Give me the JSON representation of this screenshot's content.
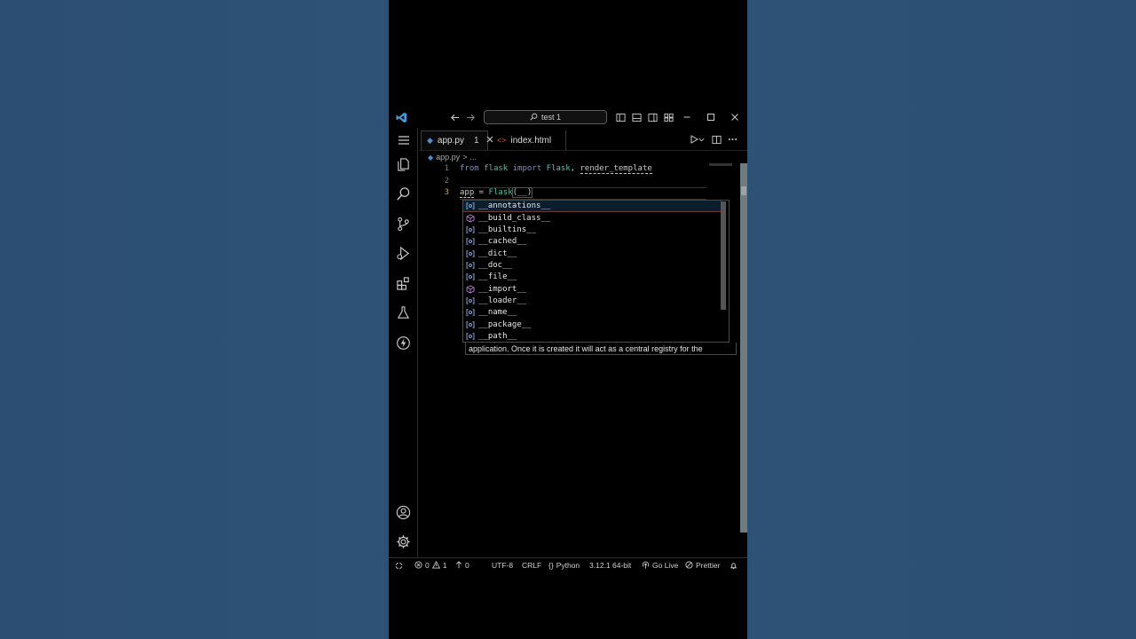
{
  "window": {
    "search_text": "test 1"
  },
  "tabs": [
    {
      "label": "app.py",
      "badge": "1"
    },
    {
      "label": "index.html"
    }
  ],
  "breadcrumb": {
    "file": "app.py",
    "sep": ">",
    "rest": "..."
  },
  "editor": {
    "lines": [
      {
        "number": "1"
      },
      {
        "number": "2"
      },
      {
        "number": "3"
      }
    ],
    "line1": {
      "from": "from",
      "module": "flask",
      "import": "import",
      "name1": "Flask",
      "comma": ", ",
      "name2": "render_template"
    },
    "line3": {
      "var": "app",
      "eq": " = ",
      "call": "Flask",
      "args": "(__)"
    }
  },
  "suggestions": [
    {
      "label": "__annotations__",
      "kind": "variable-icon"
    },
    {
      "label": "__build_class__",
      "kind": "module-icon"
    },
    {
      "label": "__builtins__",
      "kind": "variable-icon"
    },
    {
      "label": "__cached__",
      "kind": "variable-icon"
    },
    {
      "label": "__dict__",
      "kind": "variable-icon"
    },
    {
      "label": "__doc__",
      "kind": "variable-icon"
    },
    {
      "label": "__file__",
      "kind": "variable-icon"
    },
    {
      "label": "__import__",
      "kind": "module-icon"
    },
    {
      "label": "__loader__",
      "kind": "variable-icon"
    },
    {
      "label": "__name__",
      "kind": "variable-icon"
    },
    {
      "label": "__package__",
      "kind": "variable-icon"
    },
    {
      "label": "__path__",
      "kind": "variable-icon"
    }
  ],
  "docs_text": "application. Once it is created it will act as a central registry for the",
  "status": {
    "errors": "0",
    "warnings": "1",
    "info": "0",
    "encoding": "UTF-8",
    "eol": "CRLF",
    "language": "Python",
    "interpreter": "3.12.1 64-bit",
    "go_live": "Go Live",
    "prettier": "Prettier"
  },
  "colors": {
    "vscode_blue": "#3aa0e8",
    "keyword": "#7a8fbf",
    "function": "#4fc1a8",
    "line_number_active": "#c9a061"
  }
}
